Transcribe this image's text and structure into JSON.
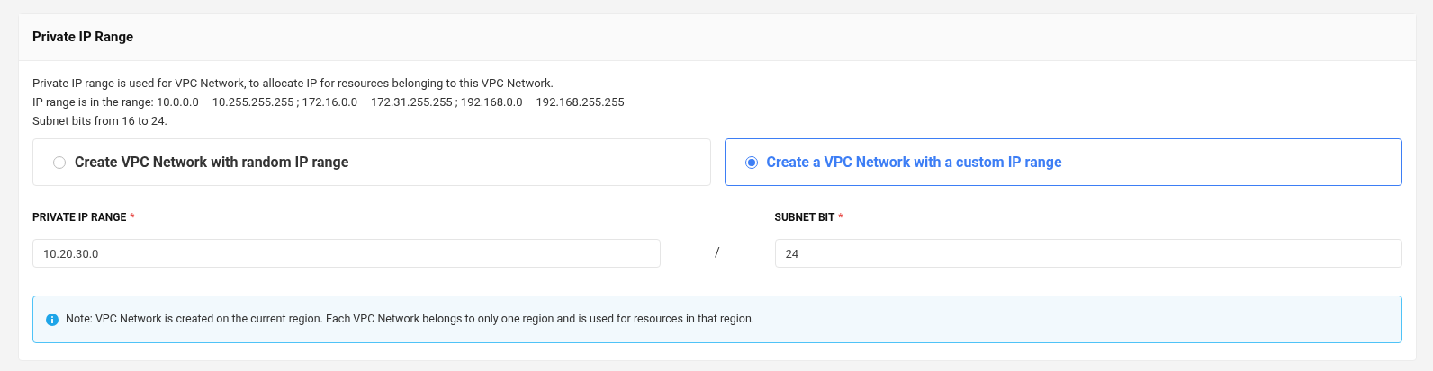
{
  "card": {
    "title": "Private IP Range"
  },
  "description": [
    "Private IP range is used for VPC Network, to allocate IP for resources belonging to this VPC Network.",
    "IP range is in the range: 10.0.0.0 – 10.255.255.255 ; 172.16.0.0 – 172.31.255.255 ; 192.168.0.0 – 192.168.255.255",
    "Subnet bits from 16 to 24."
  ],
  "options": [
    {
      "label": "Create VPC Network with random IP range",
      "selected": false
    },
    {
      "label": "Create a VPC Network with a custom IP range",
      "selected": true
    }
  ],
  "fields": [
    {
      "label": "PRIVATE IP RANGE",
      "required": "*",
      "value": "10.20.30.0"
    },
    {
      "label": "SUBNET BIT",
      "required": "*",
      "value": "24"
    }
  ],
  "separator": "/",
  "note": "Note: VPC Network is created on the current region. Each VPC Network belongs to only one region and is used for resources in that region."
}
